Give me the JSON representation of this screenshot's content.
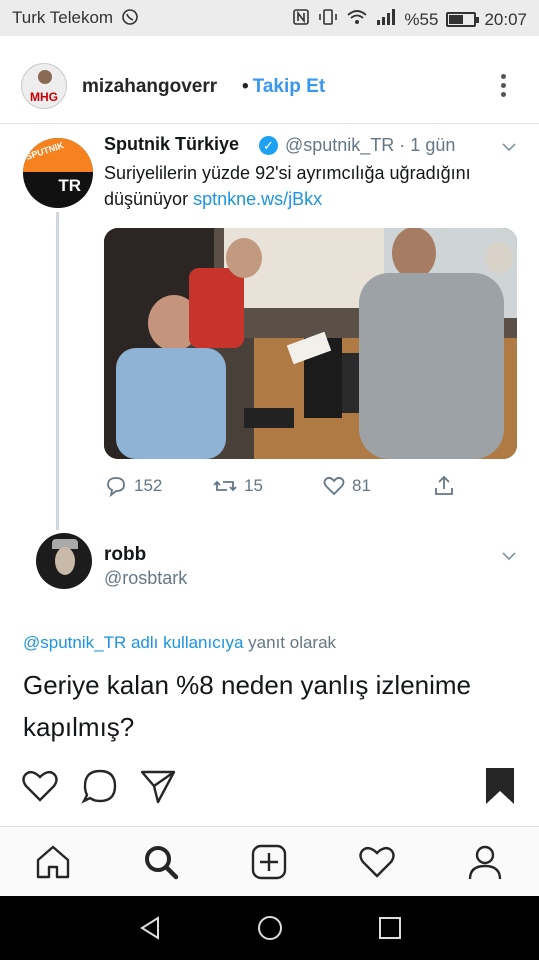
{
  "status_bar": {
    "carrier": "Turk Telekom",
    "battery": "%55",
    "battery_level": 0.55,
    "time": "20:07"
  },
  "post": {
    "username": "mizahangoverr",
    "follow_label": "Takip Et",
    "avatar_text": "MHG"
  },
  "tweet": {
    "name": "Sputnik Türkiye",
    "handle": "@sputnik_TR · 1 gün",
    "text": "Suriyelilerin yüzde 92'si ayrımcılığa uğradığını düşünüyor",
    "link": "sptnkne.ws/jBkx",
    "avatar_text_top": "SPUTNIK",
    "avatar_text_bottom": "TR",
    "replies": "152",
    "retweets": "15",
    "likes": "81"
  },
  "reply": {
    "name": "robb",
    "handle": "@rosbtark",
    "replying_mention": "@sputnik_TR adlı kullanıcıya",
    "replying_suffix": "yanıt olarak",
    "text": "Geriye kalan %8 neden yanlış izlenime kapılmış?"
  },
  "colors": {
    "twitter_blue": "#1da1f2",
    "link_blue": "#1b95e0",
    "instagram_blue": "#3897f0",
    "muted": "#657786"
  },
  "icons": {
    "like": "heart-icon",
    "comment": "comment-icon",
    "share": "send-icon",
    "save": "bookmark-icon",
    "home": "home-icon",
    "search": "search-icon",
    "add": "add-post-icon",
    "activity": "activity-heart-icon",
    "profile": "profile-icon"
  }
}
